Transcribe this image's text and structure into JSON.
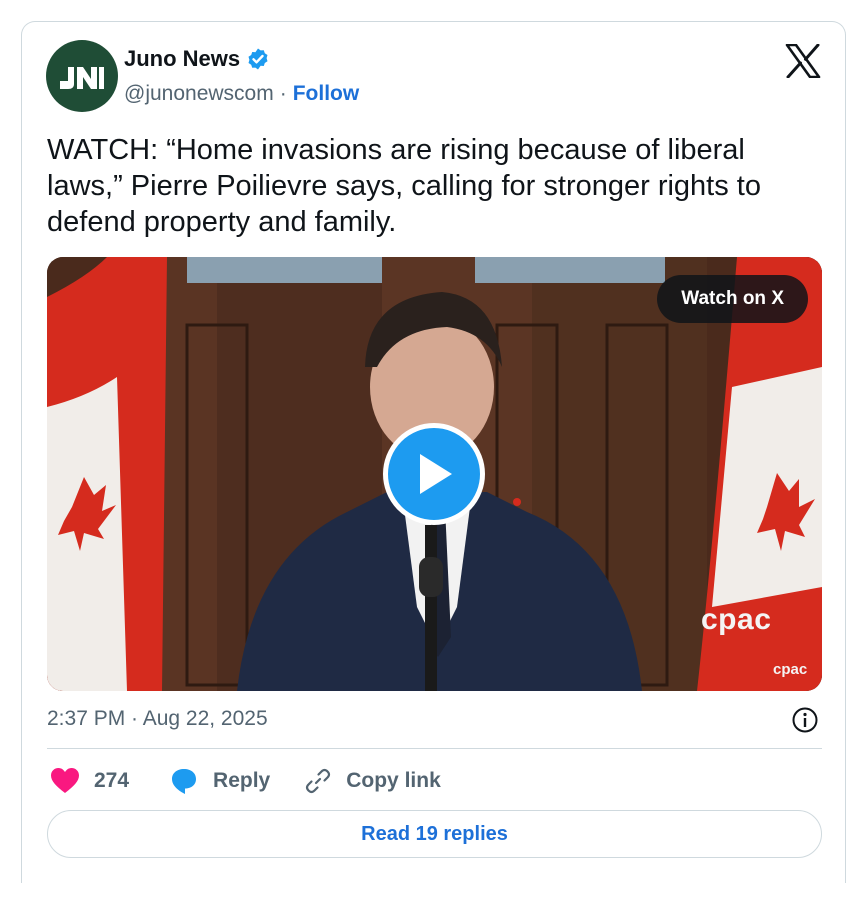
{
  "author": {
    "name": "Juno News",
    "handle": "@junonewscom",
    "separator": "·",
    "follow_label": "Follow",
    "avatar_text": "JN",
    "verified": true
  },
  "tweet": {
    "text": "WATCH: “Home invasions are rising because of liberal laws,” Pierre Poilievre says, calling for stronger rights to defend property and family."
  },
  "media": {
    "watch_label": "Watch on X",
    "watermark_large": "cpac",
    "watermark_small": "cpac"
  },
  "meta": {
    "timestamp": "2:37 PM · Aug 22, 2025"
  },
  "actions": {
    "like_count": "274",
    "reply_label": "Reply",
    "copy_link_label": "Copy link"
  },
  "footer": {
    "read_replies_label": "Read 19 replies"
  },
  "colors": {
    "link_blue": "#1d70d8",
    "play_blue": "#1d9bf0",
    "like_pink": "#f91880",
    "secondary_text": "#536471",
    "border": "#cfd9de"
  },
  "icons": [
    "verified-badge-icon",
    "x-logo-icon",
    "play-icon",
    "info-icon",
    "heart-icon",
    "reply-bubble-icon",
    "link-icon"
  ]
}
